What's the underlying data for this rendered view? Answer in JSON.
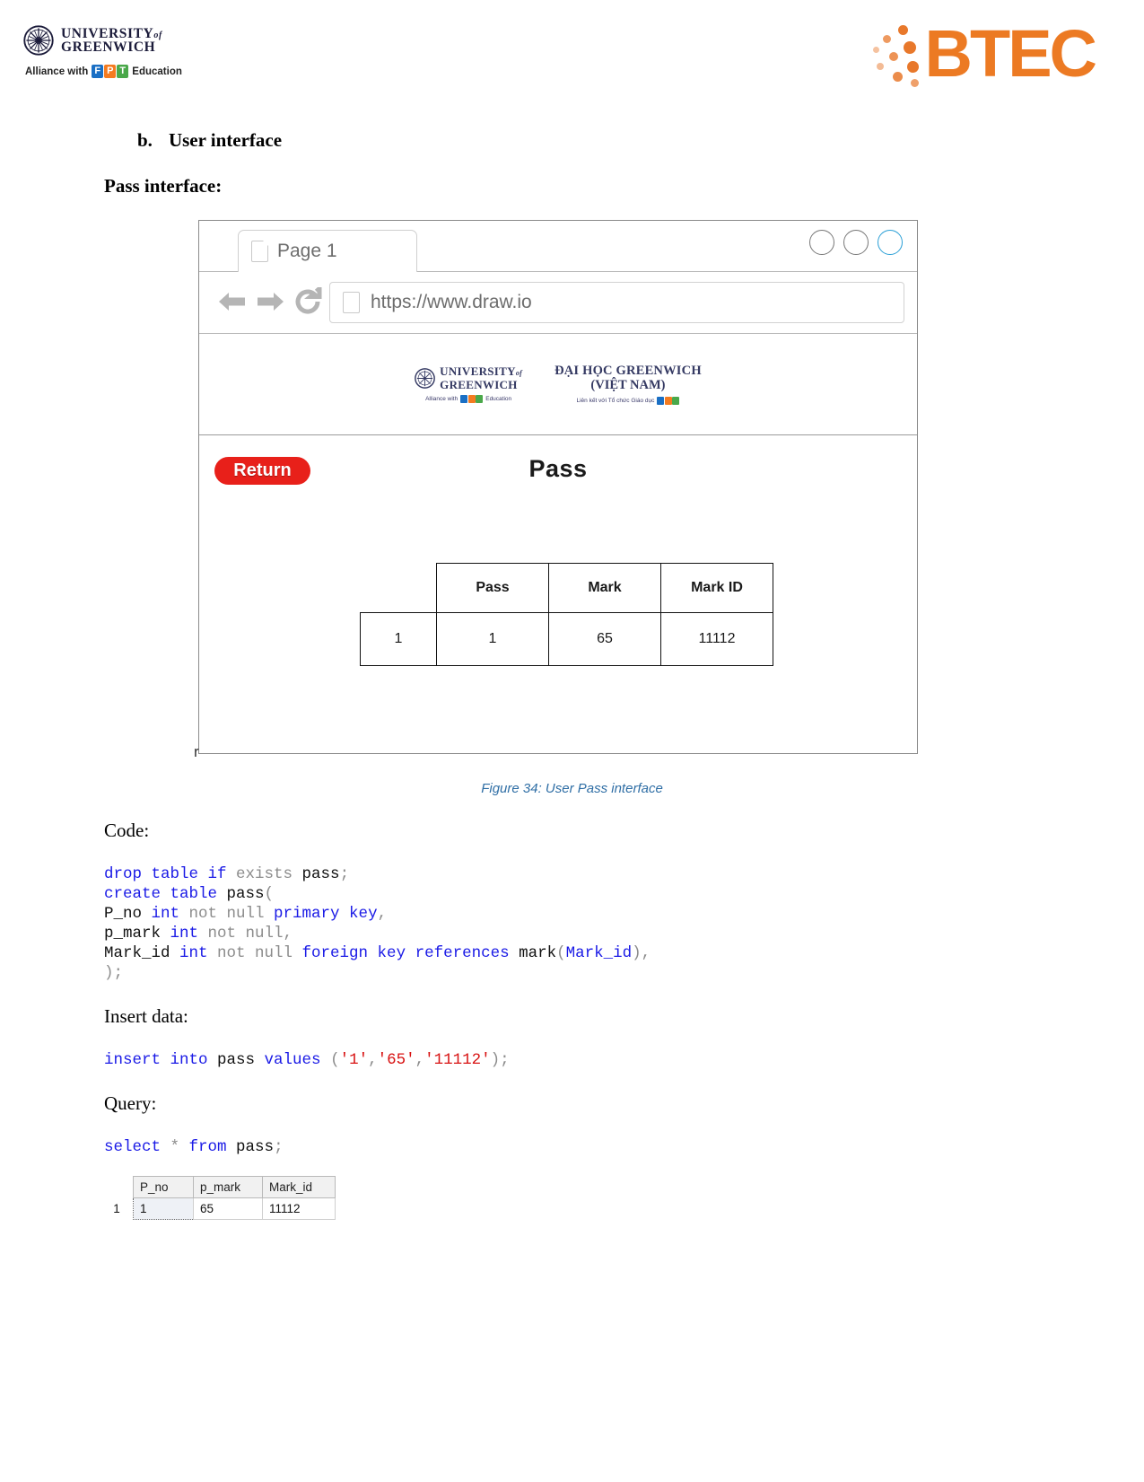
{
  "letterhead": {
    "university": {
      "line1": "UNIVERSITY",
      "of": "of",
      "line2": "GREENWICH"
    },
    "alliance": {
      "text": "Alliance with",
      "fpt": [
        "F",
        "P",
        "T"
      ],
      "education": "Education"
    },
    "btec": {
      "word": "BTEC"
    }
  },
  "headings": {
    "section_number": "b.",
    "section_title": "User interface",
    "subsection": "Pass interface:"
  },
  "browser": {
    "tab_label": "Page 1",
    "tab_icon": "document-icon",
    "window_buttons": [
      "minimize",
      "maximize",
      "close"
    ],
    "nav": {
      "back": "back-arrow-icon",
      "forward": "forward-arrow-icon",
      "reload": "reload-icon"
    },
    "url": "https://www.draw.io",
    "url_icon": "document-icon",
    "page_header": {
      "left_logo": {
        "line1": "UNIVERSITY",
        "of": "of",
        "line2": "GREENWICH",
        "sub_text": "Alliance with",
        "sub_fpt": [
          "F",
          "P",
          "T"
        ],
        "sub_edu": "Education"
      },
      "right_logo": {
        "line1": "ĐẠI HỌC GREENWICH",
        "line2": "(VIỆT NAM)",
        "sub_text": "Liên kết với Tổ chức Giáo dục",
        "sub_fpt": [
          "F",
          "P",
          "T"
        ]
      }
    },
    "return_button": "Return",
    "page_title": "Pass",
    "table": {
      "corner": "",
      "headers": [
        "Pass",
        "Mark",
        "Mark ID"
      ],
      "rows": [
        {
          "index": "1",
          "cells": [
            "1",
            "65",
            "11112"
          ]
        }
      ]
    },
    "stub_text": "r"
  },
  "figure_caption": "Figure 34: User Pass interface",
  "code_section": {
    "code_label": "Code:",
    "create_lines": [
      [
        {
          "t": "drop table if ",
          "c": "kw"
        },
        {
          "t": "exists ",
          "c": "gy"
        },
        {
          "t": "pass",
          "c": "id"
        },
        {
          "t": ";",
          "c": "pn"
        }
      ],
      [
        {
          "t": "create table ",
          "c": "kw"
        },
        {
          "t": "pass",
          "c": "id"
        },
        {
          "t": "(",
          "c": "pn"
        }
      ],
      [
        {
          "t": "P_no ",
          "c": "id"
        },
        {
          "t": "int ",
          "c": "kw"
        },
        {
          "t": "not null ",
          "c": "gy"
        },
        {
          "t": "primary key",
          "c": "kw"
        },
        {
          "t": ",",
          "c": "pn"
        }
      ],
      [
        {
          "t": "p_mark ",
          "c": "id"
        },
        {
          "t": "int ",
          "c": "kw"
        },
        {
          "t": "not null",
          "c": "gy"
        },
        {
          "t": ",",
          "c": "pn"
        }
      ],
      [
        {
          "t": "Mark_id ",
          "c": "id"
        },
        {
          "t": "int ",
          "c": "kw"
        },
        {
          "t": "not null ",
          "c": "gy"
        },
        {
          "t": "foreign key references ",
          "c": "kw"
        },
        {
          "t": "mark",
          "c": "id"
        },
        {
          "t": "(",
          "c": "pn"
        },
        {
          "t": "Mark_id",
          "c": "kw"
        },
        {
          "t": "),",
          "c": "pn"
        }
      ],
      [
        {
          "t": ");",
          "c": "pn"
        }
      ]
    ],
    "insert_label": "Insert data:",
    "insert_lines": [
      [
        {
          "t": "insert into ",
          "c": "kw"
        },
        {
          "t": "pass ",
          "c": "id"
        },
        {
          "t": "values ",
          "c": "kw"
        },
        {
          "t": "(",
          "c": "pn"
        },
        {
          "t": "'1'",
          "c": "str"
        },
        {
          "t": ",",
          "c": "pn"
        },
        {
          "t": "'65'",
          "c": "str"
        },
        {
          "t": ",",
          "c": "pn"
        },
        {
          "t": "'11112'",
          "c": "str"
        },
        {
          "t": ");",
          "c": "pn"
        }
      ]
    ],
    "query_label": "Query:",
    "query_lines": [
      [
        {
          "t": "select ",
          "c": "kw"
        },
        {
          "t": "* ",
          "c": "gy"
        },
        {
          "t": "from ",
          "c": "kw"
        },
        {
          "t": "pass",
          "c": "id"
        },
        {
          "t": ";",
          "c": "pn"
        }
      ]
    ]
  },
  "result_grid": {
    "row_header": "1",
    "columns": [
      "P_no",
      "p_mark",
      "Mark_id"
    ],
    "rows": [
      {
        "num": "1",
        "values": [
          "1",
          "65",
          "11112"
        ]
      }
    ]
  },
  "colors": {
    "btec_orange": "#ec7a23",
    "return_red": "#e8201a",
    "caption_blue": "#2f6ea5",
    "keyword_blue": "#1a1ae6",
    "string_red": "#d81212",
    "comment_gray": "#8c8c8c",
    "logo_navy": "#353a63"
  }
}
